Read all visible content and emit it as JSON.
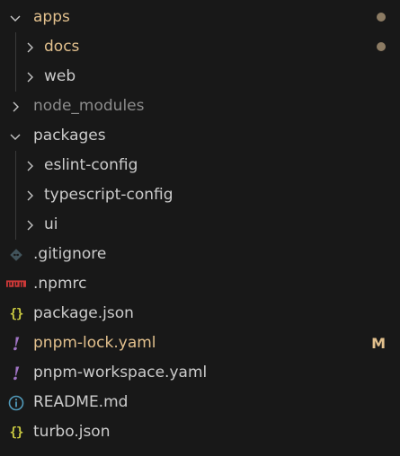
{
  "explorer": {
    "items": [
      {
        "label": "apps",
        "icon": "chevron-down-icon"
      },
      {
        "label": "docs",
        "icon": "chevron-right-icon"
      },
      {
        "label": "web",
        "icon": "chevron-right-icon"
      },
      {
        "label": "node_modules",
        "icon": "chevron-right-icon"
      },
      {
        "label": "packages",
        "icon": "chevron-down-icon"
      },
      {
        "label": "eslint-config",
        "icon": "chevron-right-icon"
      },
      {
        "label": "typescript-config",
        "icon": "chevron-right-icon"
      },
      {
        "label": "ui",
        "icon": "chevron-right-icon"
      },
      {
        "label": ".gitignore",
        "icon": "git-icon"
      },
      {
        "label": ".npmrc",
        "icon": "npm-icon"
      },
      {
        "label": "package.json",
        "icon": "json-icon",
        "glyph": "{}"
      },
      {
        "label": "pnpm-lock.yaml",
        "icon": "yaml-icon",
        "glyph": "!",
        "status": "M"
      },
      {
        "label": "pnpm-workspace.yaml",
        "icon": "yaml-icon",
        "glyph": "!"
      },
      {
        "label": "README.md",
        "icon": "info-icon"
      },
      {
        "label": "turbo.json",
        "icon": "json-icon",
        "glyph": "{}"
      }
    ]
  },
  "colors": {
    "background": "#181818",
    "text": "#cccccc",
    "modified": "#e2c08d",
    "ignored": "#8c8c8c",
    "json": "#cbcb41",
    "yaml": "#a074c4",
    "git": "#41535b",
    "npm": "#cb3837",
    "info": "#519aba"
  }
}
